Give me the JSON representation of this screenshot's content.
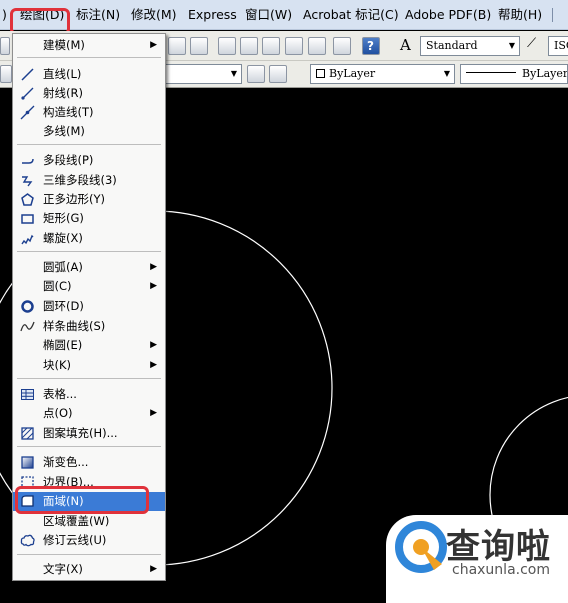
{
  "menubar": {
    "items": [
      ")",
      "绘图(D)",
      "标注(N)",
      "修改(M)",
      "Express",
      "窗口(W)",
      "Acrobat 标记(C)",
      "Adobe PDF(B)",
      "帮助(H)"
    ]
  },
  "toolbar": {
    "text_style": "Standard",
    "dim_style": "ISO",
    "layer_color": "ByLayer",
    "linetype": "ByLayer"
  },
  "draw_menu": {
    "items": [
      {
        "label": "建模(M)",
        "icon": "none",
        "submenu": true
      },
      {
        "label": "直线(L)",
        "icon": "line-icon"
      },
      {
        "label": "射线(R)",
        "icon": "ray-icon"
      },
      {
        "label": "构造线(T)",
        "icon": "construction-line-icon"
      },
      {
        "label": "多线(M)",
        "icon": "none"
      },
      {
        "label": "多段线(P)",
        "icon": "polyline-icon"
      },
      {
        "label": "三维多段线(3)",
        "icon": "3d-polyline-icon"
      },
      {
        "label": "正多边形(Y)",
        "icon": "polygon-icon"
      },
      {
        "label": "矩形(G)",
        "icon": "rectangle-icon"
      },
      {
        "label": "螺旋(X)",
        "icon": "helix-icon"
      },
      {
        "label": "圆弧(A)",
        "icon": "none",
        "submenu": true
      },
      {
        "label": "圆(C)",
        "icon": "none",
        "submenu": true
      },
      {
        "label": "圆环(D)",
        "icon": "donut-icon"
      },
      {
        "label": "样条曲线(S)",
        "icon": "spline-icon"
      },
      {
        "label": "椭圆(E)",
        "icon": "none",
        "submenu": true
      },
      {
        "label": "块(K)",
        "icon": "none",
        "submenu": true
      },
      {
        "label": "表格...",
        "icon": "table-icon"
      },
      {
        "label": "点(O)",
        "icon": "none",
        "submenu": true
      },
      {
        "label": "图案填充(H)...",
        "icon": "hatch-icon"
      },
      {
        "label": "渐变色...",
        "icon": "gradient-icon"
      },
      {
        "label": "边界(B)...",
        "icon": "boundary-icon"
      },
      {
        "label": "面域(N)",
        "icon": "region-icon",
        "selected": true
      },
      {
        "label": "区域覆盖(W)",
        "icon": "none"
      },
      {
        "label": "修订云线(U)",
        "icon": "revcloud-icon"
      },
      {
        "label": "文字(X)",
        "icon": "none",
        "submenu": true
      }
    ]
  },
  "watermark": {
    "brand_cn": "查询啦",
    "url": "chaxunla.com"
  },
  "colors": {
    "menubar_bg": "#d7e2f1",
    "selection": "#3b7bd6",
    "highlight_box": "#e0323b",
    "canvas_bg": "#000000"
  }
}
